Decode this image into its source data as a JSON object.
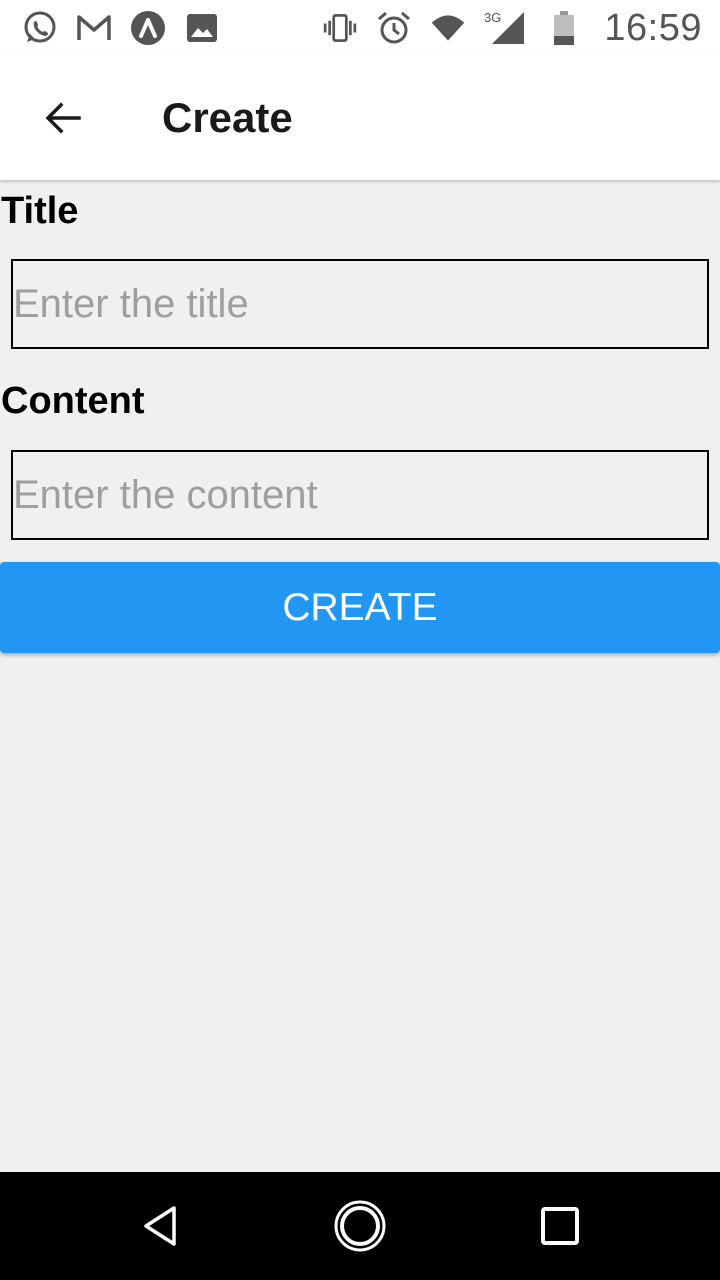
{
  "status_bar": {
    "time": "16:59",
    "network": "3G",
    "left_icons": [
      "whatsapp-icon",
      "gmail-icon",
      "app-notification-icon",
      "image-icon"
    ],
    "right_icons": [
      "vibrate-icon",
      "alarm-icon",
      "wifi-icon",
      "signal-icon",
      "battery-icon"
    ]
  },
  "app_bar": {
    "title": "Create",
    "back_icon": "arrow-back-icon"
  },
  "form": {
    "title_label": "Title",
    "title_placeholder": "Enter the title",
    "title_value": "",
    "content_label": "Content",
    "content_placeholder": "Enter the content",
    "content_value": "",
    "submit_label": "CREATE"
  },
  "nav_bar": {
    "icons": [
      "nav-back-icon",
      "nav-home-icon",
      "nav-recents-icon"
    ]
  },
  "colors": {
    "accent": "#2196f3",
    "background": "#f0f0f0",
    "appbar": "#ffffff",
    "navbar": "#000000"
  }
}
